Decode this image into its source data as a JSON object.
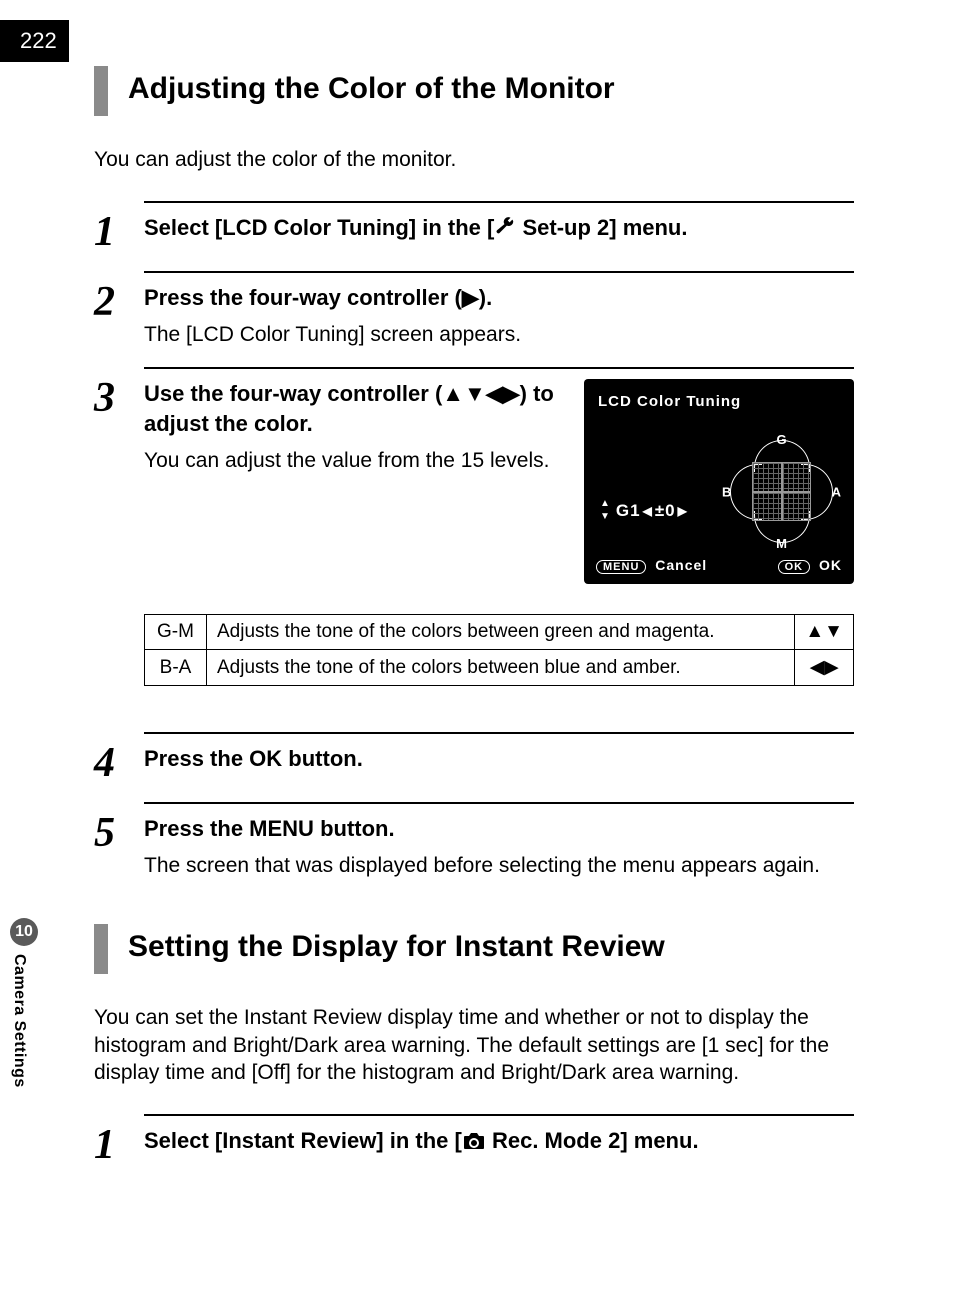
{
  "page_number": "222",
  "side": {
    "chapter_number": "10",
    "chapter_label": "Camera Settings"
  },
  "section1": {
    "heading": "Adjusting the Color of the Monitor",
    "intro": "You can adjust the color of the monitor.",
    "steps": {
      "1": {
        "title_before": "Select [LCD Color Tuning] in the [",
        "title_after": " Set-up 2] menu."
      },
      "2": {
        "title": "Press the four-way controller (▶).",
        "desc": "The [LCD Color Tuning] screen appears."
      },
      "3": {
        "title": "Use the four-way controller (▲▼◀▶) to adjust the color.",
        "desc": "You can adjust the value from the 15 levels."
      },
      "4": {
        "title_before": "Press the ",
        "ok": "OK",
        "title_after": " button."
      },
      "5": {
        "title_before": "Press the ",
        "menu": "MENU",
        "title_after": " button.",
        "desc": "The screen that was displayed before selecting the menu appears again."
      }
    },
    "lcd": {
      "title": "LCD Color Tuning",
      "value_line": {
        "g": "G1",
        "pm": "±0"
      },
      "axis": {
        "g": "G",
        "m": "M",
        "b": "B",
        "a": "A"
      },
      "cancel_label": "Cancel",
      "menu_pill": "MENU",
      "ok_pill": "OK",
      "ok_label": "OK"
    },
    "table": {
      "row1": {
        "key": "G-M",
        "desc": "Adjusts the tone of the colors between green and magenta.",
        "arrows": "▲▼"
      },
      "row2": {
        "key": "B-A",
        "desc": "Adjusts the tone of the colors between blue and amber.",
        "arrows": "◀▶"
      }
    }
  },
  "section2": {
    "heading": "Setting the Display for Instant Review",
    "intro": "You can set the Instant Review display time and whether or not to display the histogram and Bright/Dark area warning. The default settings are [1 sec] for the display time and [Off] for the histogram and Bright/Dark area warning.",
    "steps": {
      "1": {
        "title_before": "Select [Instant Review] in the [",
        "title_after": " Rec. Mode 2] menu."
      }
    }
  }
}
